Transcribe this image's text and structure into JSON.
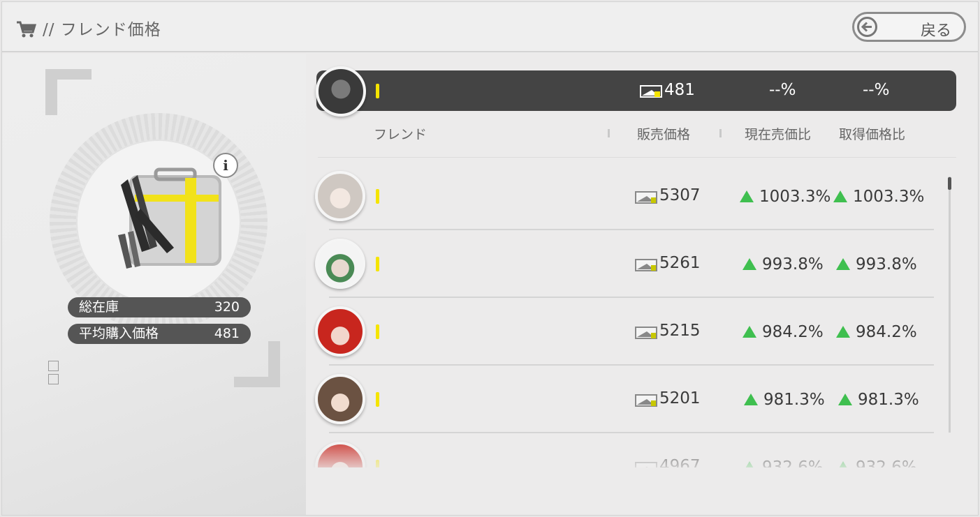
{
  "header": {
    "title": "// フレンド価格",
    "back_label": "戻る"
  },
  "item": {
    "stats": [
      {
        "label": "総在庫",
        "value": "320"
      },
      {
        "label": "平均購入価格",
        "value": "481"
      }
    ]
  },
  "self": {
    "price": "481",
    "current_ratio": "--%",
    "acquired_ratio": "--%"
  },
  "columns": {
    "friend": "フレンド",
    "price": "販売価格",
    "current_ratio": "現在売価比",
    "acquired_ratio": "取得価格比"
  },
  "friends": [
    {
      "price": "5307",
      "current_ratio": "1003.3%",
      "acquired_ratio": "1003.3%"
    },
    {
      "price": "5261",
      "current_ratio": "993.8%",
      "acquired_ratio": "993.8%"
    },
    {
      "price": "5215",
      "current_ratio": "984.2%",
      "acquired_ratio": "984.2%"
    },
    {
      "price": "5201",
      "current_ratio": "981.3%",
      "acquired_ratio": "981.3%"
    },
    {
      "price": "4967",
      "current_ratio": "932.6%",
      "acquired_ratio": "932.6%"
    }
  ],
  "colors": {
    "accent_yellow": "#f5e400",
    "up_green": "#3fbf4f",
    "bar_dark": "#444444"
  }
}
